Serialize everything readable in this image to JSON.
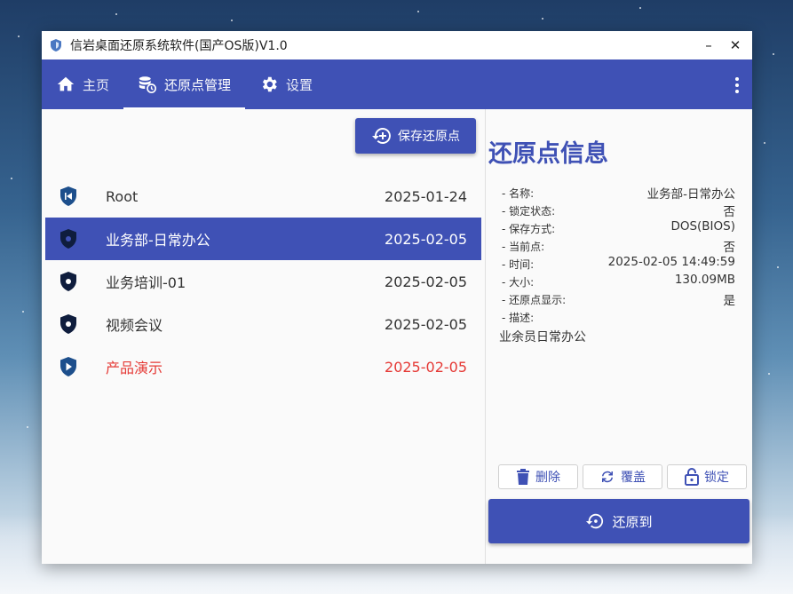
{
  "window": {
    "title": "信岩桌面还原系统软件(国产OS版)V1.0",
    "minimize": "–",
    "close": "✕"
  },
  "nav": {
    "tabs": [
      {
        "label": "主页",
        "icon": "home-icon"
      },
      {
        "label": "还原点管理",
        "icon": "database-restore-icon",
        "active": true
      },
      {
        "label": "设置",
        "icon": "gear-icon"
      }
    ],
    "more_icon": "more-vert-icon"
  },
  "toolbar": {
    "save_label": "保存还原点"
  },
  "restore_points": [
    {
      "name": "Root",
      "date": "2025-01-24",
      "icon": "shield-skip-icon"
    },
    {
      "name": "业务部-日常办公",
      "date": "2025-02-05",
      "icon": "shield-icon",
      "selected": true
    },
    {
      "name": "业务培训-01",
      "date": "2025-02-05",
      "icon": "shield-icon"
    },
    {
      "name": "视频会议",
      "date": "2025-02-05",
      "icon": "shield-icon"
    },
    {
      "name": "产品演示",
      "date": "2025-02-05",
      "icon": "shield-play-icon",
      "highlight_color": "#e53935"
    }
  ],
  "info": {
    "title": "还原点信息",
    "fields": [
      {
        "label": "- 名称:",
        "value": "业务部-日常办公"
      },
      {
        "label": "- 锁定状态:",
        "value": "否"
      },
      {
        "label": "- 保存方式:",
        "value": "DOS(BIOS)"
      },
      {
        "label": "- 当前点:",
        "value": "否"
      },
      {
        "label": "- 时间:",
        "value": "2025-02-05 14:49:59"
      },
      {
        "label": "- 大小:",
        "value": "130.09MB"
      },
      {
        "label": "- 还原点显示:",
        "value": "是"
      },
      {
        "label": "- 描述:",
        "value": ""
      }
    ],
    "description": "业余员日常办公"
  },
  "actions": {
    "delete_label": "删除",
    "overwrite_label": "覆盖",
    "lock_label": "锁定",
    "restore_label": "还原到"
  },
  "colors": {
    "primary": "#3f51b5",
    "danger": "#e53935"
  }
}
